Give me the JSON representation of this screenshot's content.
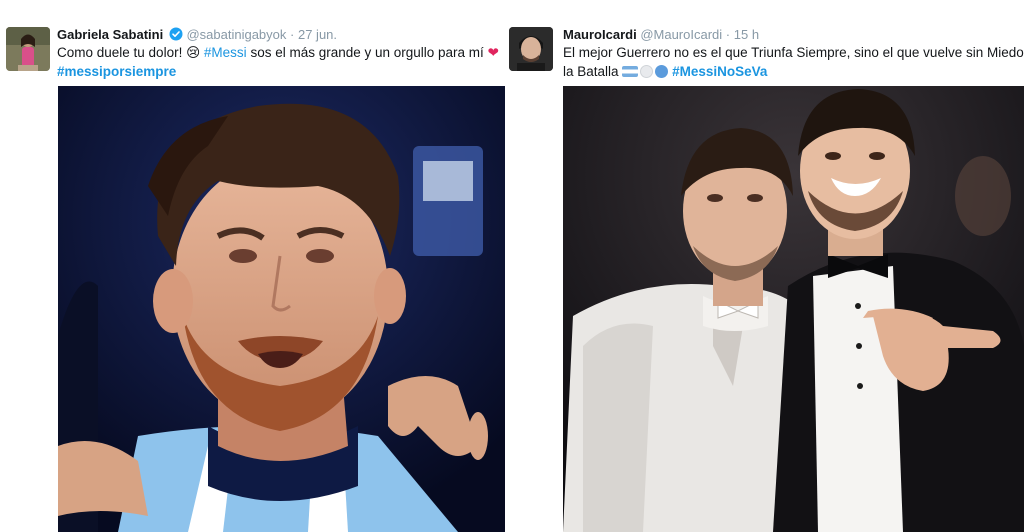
{
  "tweets": [
    {
      "name": "Gabriela Sabatini",
      "handle": "@sabatinigabyok",
      "separator": "·",
      "time": "27 jun.",
      "text_before": "Como duele tu dolor! ",
      "emoji_tear": "😢",
      "hashtag_inline": "#Messi",
      "text_after": " sos el más grande y un orgullo para mí ",
      "emoji_heart": "❤",
      "hashtag_line2": "#messiporsiempre"
    },
    {
      "name": "MauroIcardi",
      "handle": "@MauroIcardi",
      "separator": "·",
      "time": "15 h",
      "text_line1": "El mejor Guerrero no es el que Triunfa Siempre, sino el que vuelve sin Miedo a",
      "text_line2": "la Batalla ",
      "hashtag": "#MessiNoSeVa"
    }
  ],
  "colors": {
    "hashtag": "#1b95e0",
    "meta": "#8899a6",
    "verified": "#1da1f2",
    "heart": "#e0245e"
  }
}
